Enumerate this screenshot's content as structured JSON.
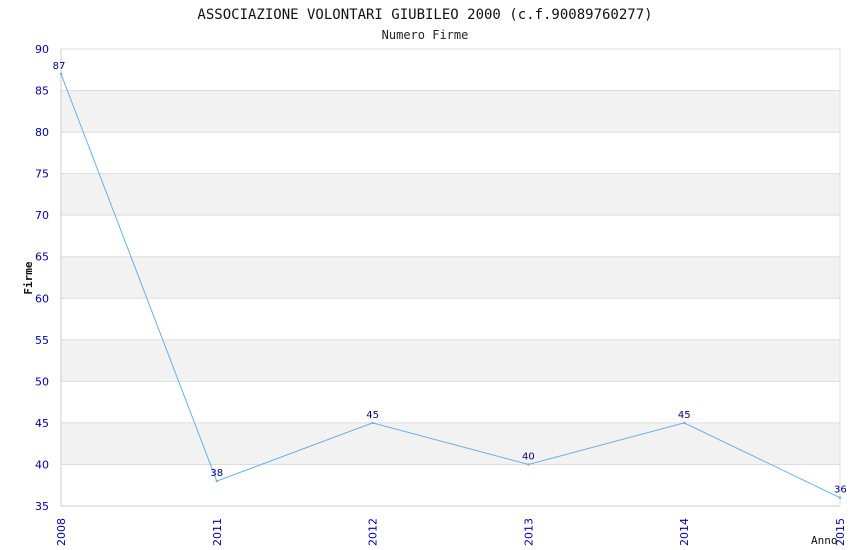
{
  "chart_data": {
    "type": "line",
    "title": "ASSOCIAZIONE VOLONTARI GIUBILEO 2000 (c.f.90089760277)",
    "subtitle": "Numero Firme",
    "xlabel": "Anno",
    "ylabel": "Firme",
    "x": [
      "2008",
      "2011",
      "2012",
      "2013",
      "2014",
      "2015"
    ],
    "series": [
      {
        "values": [
          87,
          38,
          45,
          40,
          45,
          36
        ]
      }
    ],
    "ylim": [
      35,
      90
    ],
    "yticks": [
      35,
      40,
      45,
      50,
      55,
      60,
      65,
      70,
      75,
      80,
      85,
      90
    ],
    "grid": true,
    "colors": {
      "line": "#6aaee8",
      "band": "#f2f2f2",
      "grid": "#dddddd",
      "tick_text": "#0000aa",
      "data_label": "#000080"
    }
  }
}
